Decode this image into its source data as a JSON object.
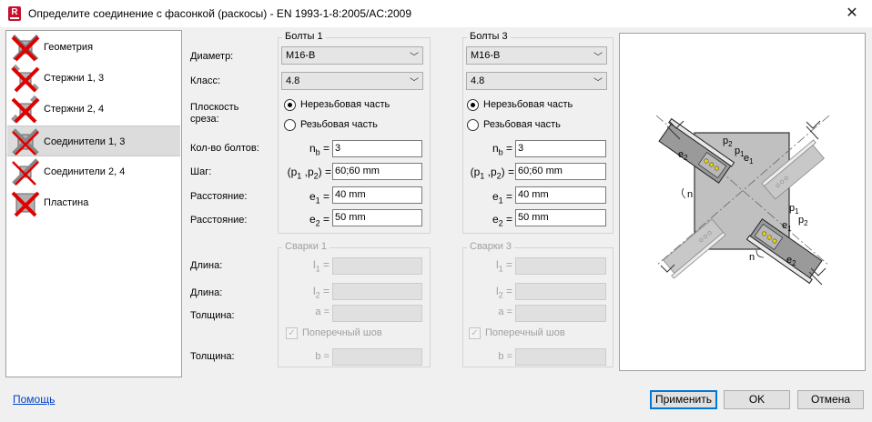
{
  "window": {
    "title": "Определите соединение с фасонкой (раскосы)  - EN 1993-1-8:2005/AC:2009",
    "app_icon_letter": "R",
    "close_glyph": "✕"
  },
  "sidebar": {
    "items": [
      {
        "label": "Геометрия",
        "icon": "red-x-gusset-icon"
      },
      {
        "label": "Стержни 1, 3",
        "icon": "red-x-bars-13-icon"
      },
      {
        "label": "Стержни 2, 4",
        "icon": "red-x-bars-24-icon"
      },
      {
        "label": "Соединители 1, 3",
        "icon": "red-x-connectors-13-icon",
        "selected": true
      },
      {
        "label": "Соединители 2, 4",
        "icon": "red-x-connectors-24-icon"
      },
      {
        "label": "Пластина",
        "icon": "red-x-plate-icon"
      }
    ]
  },
  "labels": {
    "diameter": "Диаметр:",
    "class": "Класс:",
    "shear_plane_1": "Плоскость",
    "shear_plane_2": "среза:",
    "bolt_count": "Кол-во болтов:",
    "spacing": "Шаг:",
    "distance1": "Расстояние:",
    "distance2": "Расстояние:",
    "length1": "Длина:",
    "length2": "Длина:",
    "thickness1": "Толщина:",
    "thickness2": "Толщина:"
  },
  "bolts1": {
    "title": "Болты 1",
    "diameter": "M16-B",
    "class": "4.8",
    "radio_unthreaded": "Нерезьбовая часть",
    "radio_threaded": "Резьбовая часть",
    "selected_radio": "unthreaded",
    "nb": "3",
    "pitch": "60;60 mm",
    "e1": "40 mm",
    "e2": "50 mm"
  },
  "bolts3": {
    "title": "Болты 3",
    "diameter": "M16-B",
    "class": "4.8",
    "radio_unthreaded": "Нерезьбовая часть",
    "radio_threaded": "Резьбовая часть",
    "selected_radio": "unthreaded",
    "nb": "3",
    "pitch": "60;60 mm",
    "e1": "40 mm",
    "e2": "50 mm"
  },
  "symbols": {
    "nb": "n",
    "nb_sub": "b",
    "nb_eq": " =",
    "p_open": "(p",
    "p1_sub": "1",
    "p_mid": " ,p",
    "p2_sub": "2",
    "p_close": ") =",
    "e": "e",
    "e1_sub": "1",
    "e2_sub": "2",
    "eq": " =",
    "l": "l",
    "l1_sub": "1",
    "l2_sub": "2",
    "a": "a =",
    "b": "b ="
  },
  "welds1": {
    "title": "Сварки 1",
    "transverse": "Поперечный шов",
    "transverse_checked": true
  },
  "welds3": {
    "title": "Сварки 3",
    "transverse": "Поперечный шов",
    "transverse_checked": true
  },
  "combo_arrow": "﹀",
  "check_glyph": "✓",
  "drawing": {
    "labels": {
      "p2_top": "p",
      "p2_top_sub": "2",
      "p1_top": "p",
      "p1_top_sub": "1",
      "e1_top": "e",
      "e1_top_sub": "1",
      "e2_top": "e",
      "e2_top_sub": "2",
      "n_left": "n",
      "e1_right": "e",
      "e1_right_sub": "1",
      "p1_right": "p",
      "p1_right_sub": "1",
      "p2_right": "p",
      "p2_right_sub": "2",
      "n_bottom": "n",
      "e2_bottom": "e",
      "e2_bottom_sub": "2"
    }
  },
  "footer": {
    "help": "Помощь",
    "apply": "Применить",
    "ok": "OK",
    "cancel": "Отмена"
  }
}
